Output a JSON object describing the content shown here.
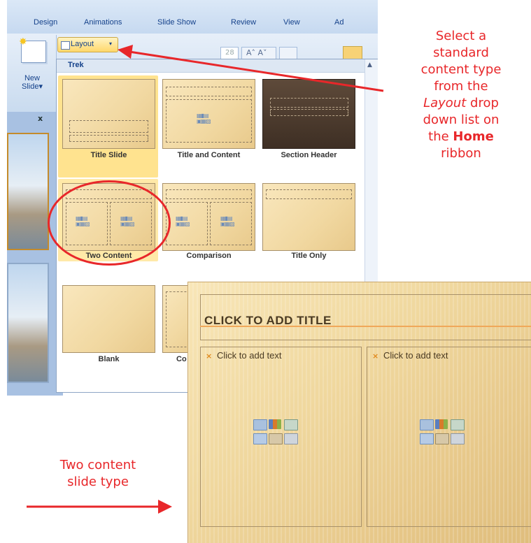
{
  "ribbon": {
    "tabs": [
      {
        "label": "Design"
      },
      {
        "label": "Animations"
      },
      {
        "label": "Slide Show"
      },
      {
        "label": "Review"
      },
      {
        "label": "View"
      },
      {
        "label": "Ad"
      }
    ],
    "new_slide_label": "New Slide",
    "new_slide_arrow": "▾",
    "layout_label": "Layout",
    "layout_arrow": "▾",
    "font_size_value": "28",
    "font_grow_label": "A˄ A˅"
  },
  "slide_panel": {
    "close_label": "x"
  },
  "gallery": {
    "theme_name": "Trek",
    "layouts": [
      {
        "label": "Title Slide"
      },
      {
        "label": "Title and Content"
      },
      {
        "label": "Section Header"
      },
      {
        "label": "Two Content"
      },
      {
        "label": "Comparison"
      },
      {
        "label": "Title Only"
      },
      {
        "label": "Blank"
      },
      {
        "label": "Co"
      }
    ]
  },
  "preview_slide": {
    "title": "CLICK TO ADD TITLE",
    "left_placeholder": "Click to add text",
    "right_placeholder": "Click to add text",
    "bullet": "×"
  },
  "annotations": {
    "top_note": {
      "line1": "Select a",
      "line2": "standard",
      "line3": "content type",
      "line4": "from the",
      "layout_word": "Layout",
      "line5_rest": " drop",
      "line6": "down list on",
      "line7_pre": "the ",
      "home_word": "Home",
      "line8": "ribbon"
    },
    "bottom_note": {
      "line1": "Two content",
      "line2": "slide type"
    },
    "colors": {
      "annotation_red": "#e8272a",
      "selection_gold": "#ffe38f"
    }
  }
}
